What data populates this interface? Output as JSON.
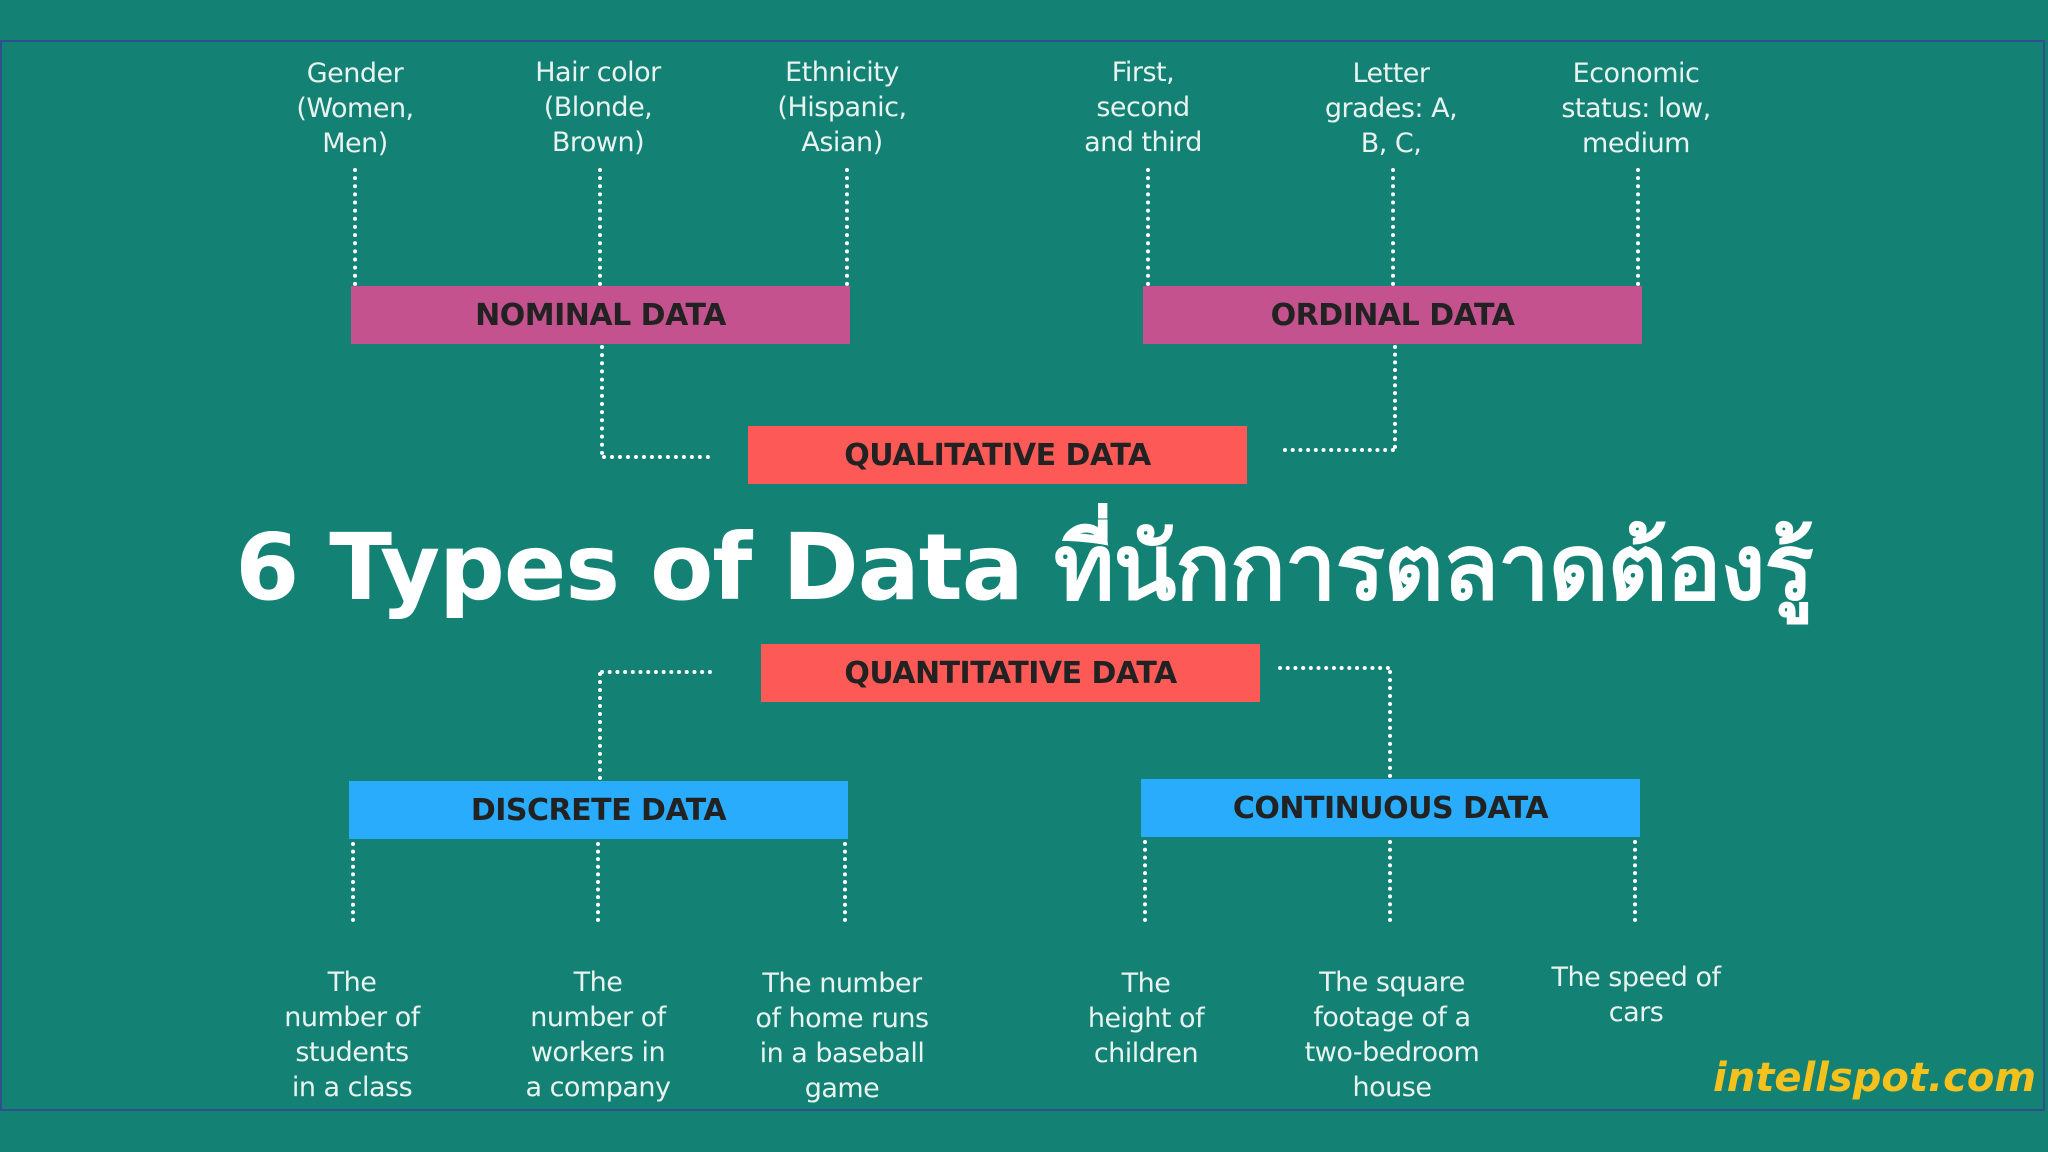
{
  "title": "6 Types of Data ที่นักการตลาดต้องรู้",
  "brand": "intellspot.com",
  "colors": {
    "background": "#138275",
    "nominal_ordinal": "#c4528e",
    "qualitative_quantitative": "#fd5a57",
    "discrete_continuous": "#29acfb",
    "brand": "#f4c11d"
  },
  "qualitative": {
    "label": "QUALITATIVE DATA",
    "nominal": {
      "label": "NOMINAL DATA",
      "examples": [
        "Gender\n(Women,\nMen)",
        "Hair color\n(Blonde,\nBrown)",
        "Ethnicity\n(Hispanic,\nAsian)"
      ]
    },
    "ordinal": {
      "label": "ORDINAL DATA",
      "examples": [
        "First,\nsecond\nand third",
        "Letter\ngrades: A,\nB, C,",
        "Economic\nstatus: low,\nmedium"
      ]
    }
  },
  "quantitative": {
    "label": "QUANTITATIVE DATA",
    "discrete": {
      "label": "DISCRETE DATA",
      "examples": [
        "The\nnumber of\nstudents\nin a class",
        "The\nnumber of\nworkers in\na company",
        "The number\nof home runs\nin a baseball\ngame"
      ]
    },
    "continuous": {
      "label": "CONTINUOUS DATA",
      "examples": [
        "The\nheight of\nchildren",
        "The square\nfootage of a\ntwo-bedroom\nhouse",
        "The speed of\ncars"
      ]
    }
  }
}
